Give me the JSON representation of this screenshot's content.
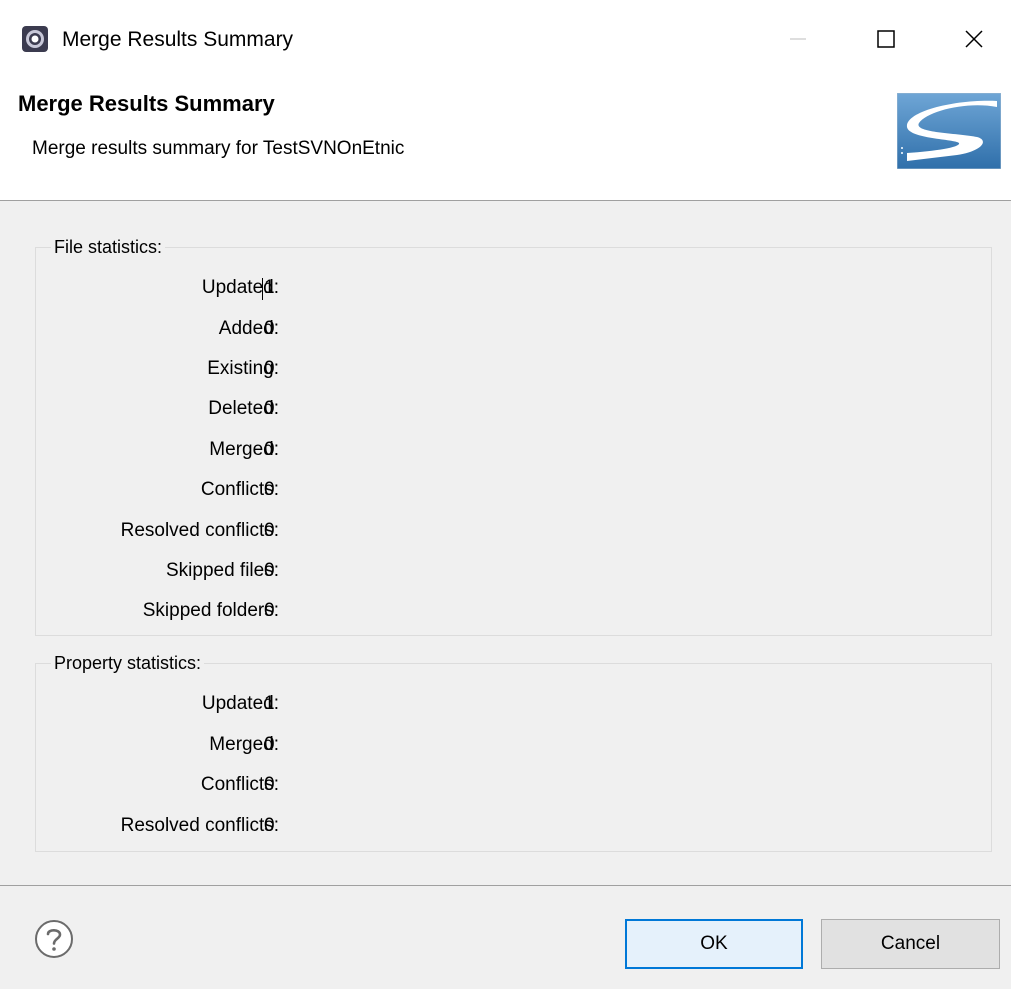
{
  "window": {
    "title": "Merge Results Summary"
  },
  "header": {
    "title": "Merge Results Summary",
    "description": "Merge results summary for TestSVNOnEtnic"
  },
  "file_statistics": {
    "legend": "File statistics:",
    "rows": [
      {
        "label": "Updated:",
        "value": "1"
      },
      {
        "label": "Added:",
        "value": "0"
      },
      {
        "label": "Existing:",
        "value": "0"
      },
      {
        "label": "Deleted:",
        "value": "0"
      },
      {
        "label": "Merged:",
        "value": "0"
      },
      {
        "label": "Conflicts:",
        "value": "0"
      },
      {
        "label": "Resolved conflicts:",
        "value": "0"
      },
      {
        "label": "Skipped files:",
        "value": "0"
      },
      {
        "label": "Skipped folders:",
        "value": "0"
      }
    ]
  },
  "property_statistics": {
    "legend": "Property statistics:",
    "rows": [
      {
        "label": "Updated:",
        "value": "1"
      },
      {
        "label": "Merged:",
        "value": "0"
      },
      {
        "label": "Conflicts:",
        "value": "0"
      },
      {
        "label": "Resolved conflicts:",
        "value": "0"
      }
    ]
  },
  "buttons": {
    "ok": "OK",
    "cancel": "Cancel"
  },
  "icons": {
    "app": "eclipse-icon",
    "help": "help-icon",
    "minimize": "minimize-icon",
    "maximize": "maximize-icon",
    "close": "close-icon",
    "banner": "svn-logo-icon"
  },
  "colors": {
    "accent": "#0078d7",
    "dialog_bg": "#f0f0f0",
    "header_bg": "#ffffff"
  }
}
